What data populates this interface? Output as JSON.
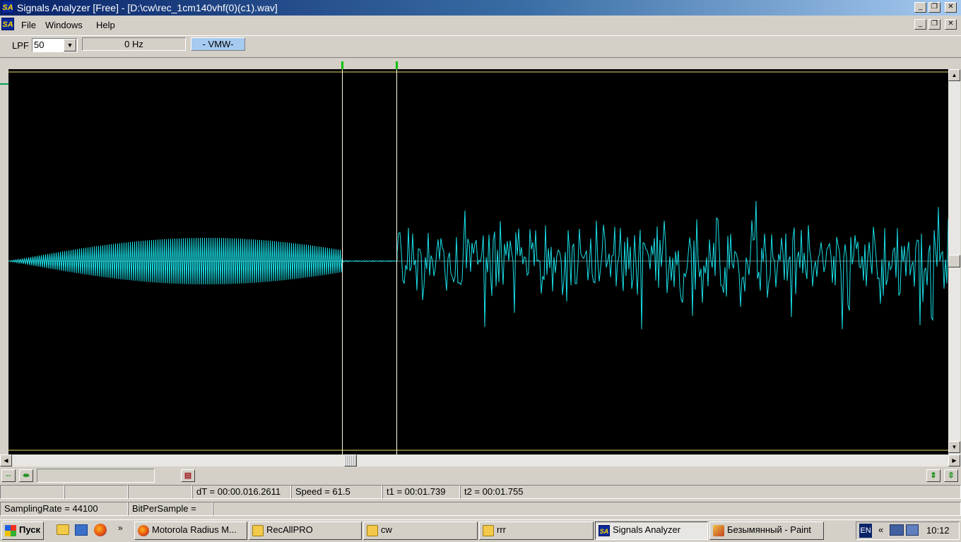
{
  "window": {
    "title": "Signals Analyzer [Free] - [D:\\cw\\rec_1cm140vhf(0)(c1).wav]",
    "logo": "SA"
  },
  "menu": [
    "File",
    "Windows",
    "Help"
  ],
  "toolbar": {
    "lpf_label": "LPF",
    "lpf_value": "50",
    "frequency": "0 Hz",
    "mode": "- VMW-"
  },
  "status_row1": {
    "dT": "dT = 00:00.016.2611",
    "speed": "Speed = 61.5",
    "t1": "t1 = 00:01.739",
    "t2": "t2 = 00:01.755"
  },
  "status_row2": {
    "sampling_rate": "SamplingRate = 44100",
    "bits": "BitPerSample ="
  },
  "taskbar": {
    "start": "Пуск",
    "tasks": [
      {
        "label": "Motorola Radius M...",
        "icon": "firefox-icon"
      },
      {
        "label": "RecAllPRO",
        "icon": "folder-icon"
      },
      {
        "label": "cw",
        "icon": "folder-icon"
      },
      {
        "label": "rrr",
        "icon": "folder-icon"
      },
      {
        "label": "Signals Analyzer",
        "icon": "sa-icon",
        "active": true
      },
      {
        "label": "Безымянный - Paint",
        "icon": "paint-icon"
      }
    ],
    "lang": "EN",
    "clock": "10:12"
  },
  "waveform": {
    "color": "#19e0e8",
    "cursor_color": "#fffbe0",
    "t1": "00:01.739",
    "t2": "00:01.755"
  }
}
